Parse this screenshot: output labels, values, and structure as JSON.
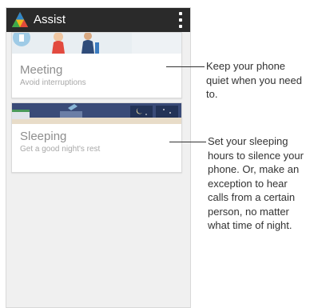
{
  "app_bar": {
    "title": "Assist",
    "logo_icon": "assist-triangle-logo-icon",
    "menu_icon": "overflow-menu-icon",
    "background": "#2a2a2a"
  },
  "cards": [
    {
      "title": "Meeting",
      "subtitle": "Avoid interruptions",
      "callout": "Keep your phone quiet when you need to."
    },
    {
      "title": "Sleeping",
      "subtitle": "Get a good night's rest",
      "callout": "Set your sleeping hours to silence your phone. Or, make an exception to hear calls from a certain person, no matter what time of night."
    }
  ]
}
